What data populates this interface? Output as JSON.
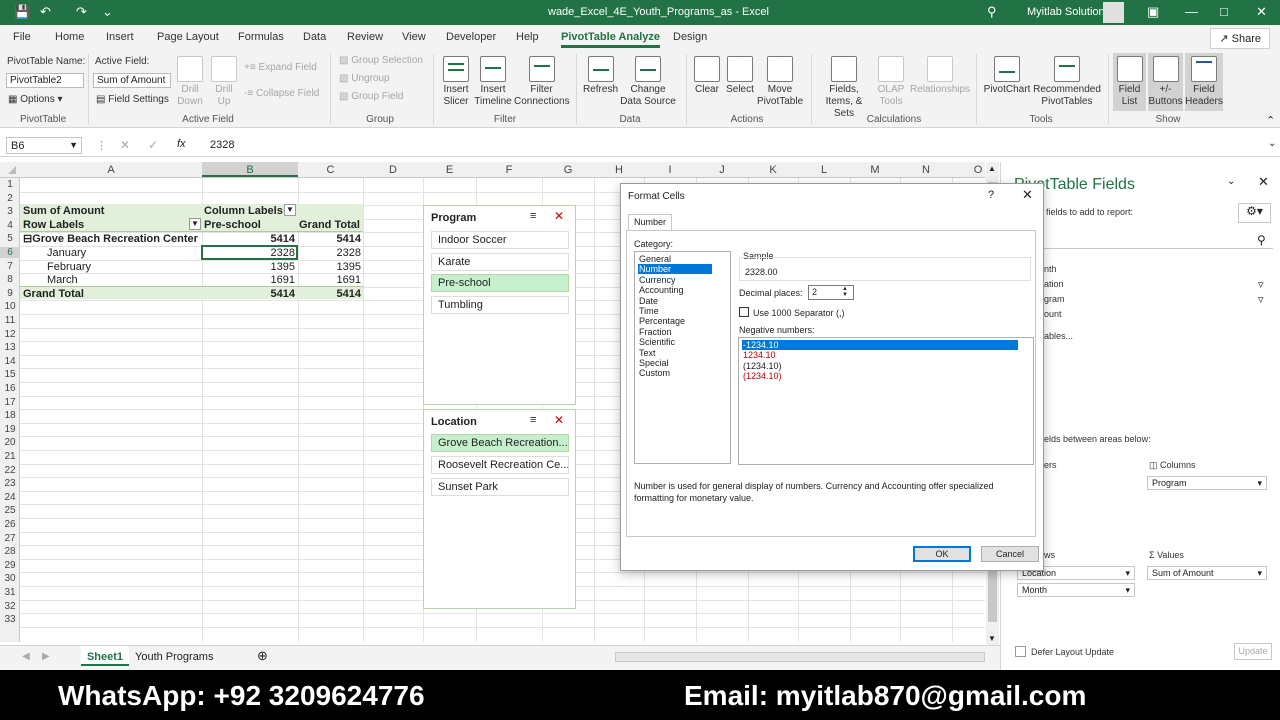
{
  "title_bar": {
    "file_name": "wade_Excel_4E_Youth_Programs_as - Excel",
    "account": "Myitlab Solution"
  },
  "menu": {
    "tabs": [
      "File",
      "Home",
      "Insert",
      "Page Layout",
      "Formulas",
      "Data",
      "Review",
      "View",
      "Developer",
      "Help",
      "PivotTable Analyze",
      "Design"
    ],
    "share": "Share"
  },
  "ribbon": {
    "pivottable_name_label": "PivotTable Name:",
    "pivottable_name": "PivotTable2",
    "options": "Options",
    "active_field_label": "Active Field:",
    "active_field": "Sum of Amount",
    "field_settings": "Field Settings",
    "drill_down": "Drill Down",
    "drill_up": "Drill Up",
    "expand_field": "Expand Field",
    "collapse_field": "Collapse Field",
    "group_selection": "Group Selection",
    "ungroup": "Ungroup",
    "group_field": "Group Field",
    "insert_slicer": "Insert Slicer",
    "insert_timeline": "Insert Timeline",
    "filter_connections": "Filter Connections",
    "refresh": "Refresh",
    "change_data_source": "Change Data Source",
    "clear": "Clear",
    "select": "Select",
    "move_pivottable": "Move PivotTable",
    "fields_items_sets": "Fields, Items, & Sets",
    "olap_tools": "OLAP Tools",
    "relationships": "Relationships",
    "pivotchart": "PivotChart",
    "recommended_pivottables": "Recommended PivotTables",
    "field_list": "Field List",
    "plus_minus_buttons": "+/- Buttons",
    "field_headers": "Field Headers",
    "groups": {
      "pivottable": "PivotTable",
      "active_field": "Active Field",
      "group": "Group",
      "filter": "Filter",
      "data": "Data",
      "actions": "Actions",
      "calculations": "Calculations",
      "tools": "Tools",
      "show": "Show"
    }
  },
  "formula_bar": {
    "name_box": "B6",
    "value": "2328"
  },
  "grid": {
    "columns": [
      "A",
      "B",
      "C",
      "D",
      "E",
      "F",
      "G",
      "H",
      "I",
      "J",
      "K",
      "L",
      "M",
      "N",
      "O"
    ],
    "rows": [
      "1",
      "2",
      "3",
      "4",
      "5",
      "6",
      "7",
      "8",
      "9",
      "10",
      "11",
      "12",
      "13",
      "14",
      "15",
      "16",
      "17",
      "18",
      "19",
      "20",
      "21",
      "22",
      "23",
      "24",
      "25",
      "26",
      "27",
      "28",
      "29",
      "30",
      "31",
      "32",
      "33"
    ],
    "pivot": {
      "sum_of_amount": "Sum of Amount",
      "column_labels": "Column Labels",
      "row_labels": "Row Labels",
      "pre_school": "Pre-school",
      "grand_total_header": "Grand Total",
      "location": "Grove Beach Recreation Center",
      "location_value": "5414",
      "location_total": "5414",
      "months": [
        {
          "label": "January",
          "value": "2328",
          "total": "2328"
        },
        {
          "label": "February",
          "value": "1395",
          "total": "1395"
        },
        {
          "label": "March",
          "value": "1691",
          "total": "1691"
        }
      ],
      "grand_total_label": "Grand Total",
      "grand_total_value": "5414",
      "grand_total_total": "5414"
    }
  },
  "slicers": {
    "program": {
      "title": "Program",
      "items": [
        "Indoor Soccer",
        "Karate",
        "Pre-school",
        "Tumbling"
      ],
      "selected": 2
    },
    "location": {
      "title": "Location",
      "items": [
        "Grove Beach Recreation...",
        "Roosevelt Recreation Ce...",
        "Sunset Park"
      ],
      "selected": 0
    }
  },
  "dialog": {
    "title": "Format Cells",
    "help": "?",
    "tab": "Number",
    "category_label": "Category:",
    "categories": [
      "General",
      "Number",
      "Currency",
      "Accounting",
      "Date",
      "Time",
      "Percentage",
      "Fraction",
      "Scientific",
      "Text",
      "Special",
      "Custom"
    ],
    "selected_category": 1,
    "sample_label": "Sample",
    "sample_value": "2328.00",
    "decimal_places_label": "Decimal places:",
    "decimal_places": "2",
    "separator_label": "Use 1000 Separator (,)",
    "negative_label": "Negative numbers:",
    "negatives": [
      "-1234.10",
      "1234.10",
      "(1234.10)",
      "(1234.10)"
    ],
    "description": "Number is used for general display of numbers.  Currency and Accounting offer specialized formatting for monetary value.",
    "ok": "OK",
    "cancel": "Cancel"
  },
  "pane": {
    "title": "PivotTable Fields",
    "choose_label": "fields to add to report:",
    "fields": [
      "nth",
      "ation",
      "gram",
      "ount"
    ],
    "more_tables": "ables...",
    "drag_label": "elds between areas below:",
    "filters_label": "ers",
    "columns_label": "Columns",
    "columns_field": "Program",
    "rows_label": "ws",
    "rows_fields": [
      "Location",
      "Month"
    ],
    "values_label": "Values",
    "values_field": "Sum of Amount",
    "defer": "Defer Layout Update",
    "update": "Update"
  },
  "sheet_tabs": [
    "Sheet1",
    "Youth Programs"
  ],
  "banner": {
    "whatsapp": "WhatsApp: +92 3209624776",
    "email": "Email: myitlab870@gmail.com"
  },
  "colors": {
    "excel_green": "#217346",
    "slicer_selected": "#c6efce",
    "accent_blue": "#0078d7",
    "negative_red": "#c00000"
  }
}
